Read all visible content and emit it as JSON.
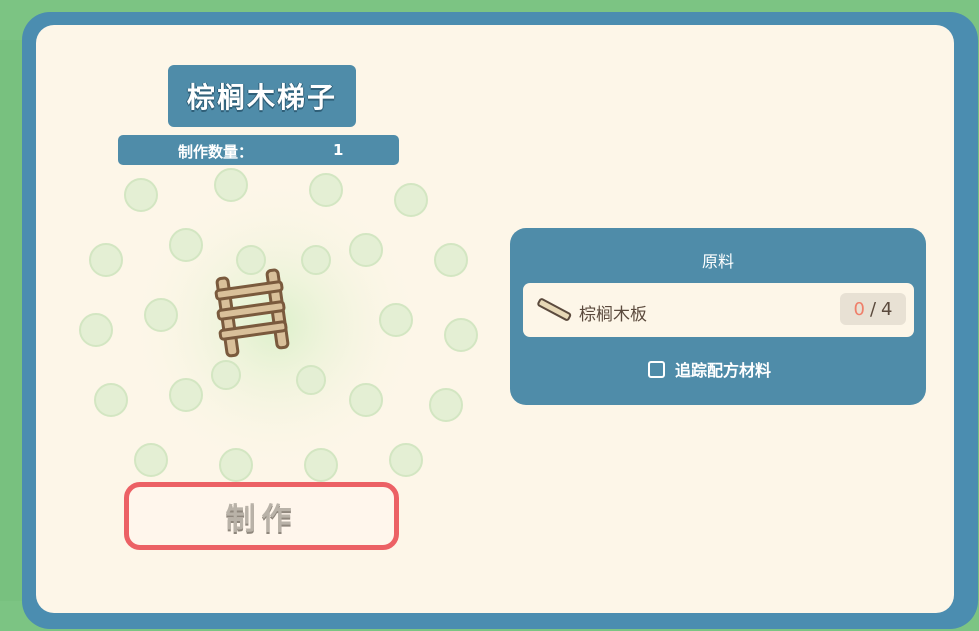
{
  "item": {
    "name": "棕榈木梯子",
    "craft_quantity_label": "制作数量：",
    "craft_quantity_value": "1",
    "icon": "ladder-icon"
  },
  "craft_button": {
    "label": "制作",
    "border_color": "#ec6165"
  },
  "materials": {
    "title": "原料",
    "items": [
      {
        "name": "棕榈木板",
        "icon": "plank-icon",
        "have": "0",
        "separator": "/",
        "need": "4"
      }
    ],
    "track_label": "追踪配方材料"
  },
  "colors": {
    "panel_blue": "#4f8ca9",
    "panel_cream": "#fdf6e8",
    "accent_red": "#ec6165",
    "count_have": "#ef7f6a"
  }
}
